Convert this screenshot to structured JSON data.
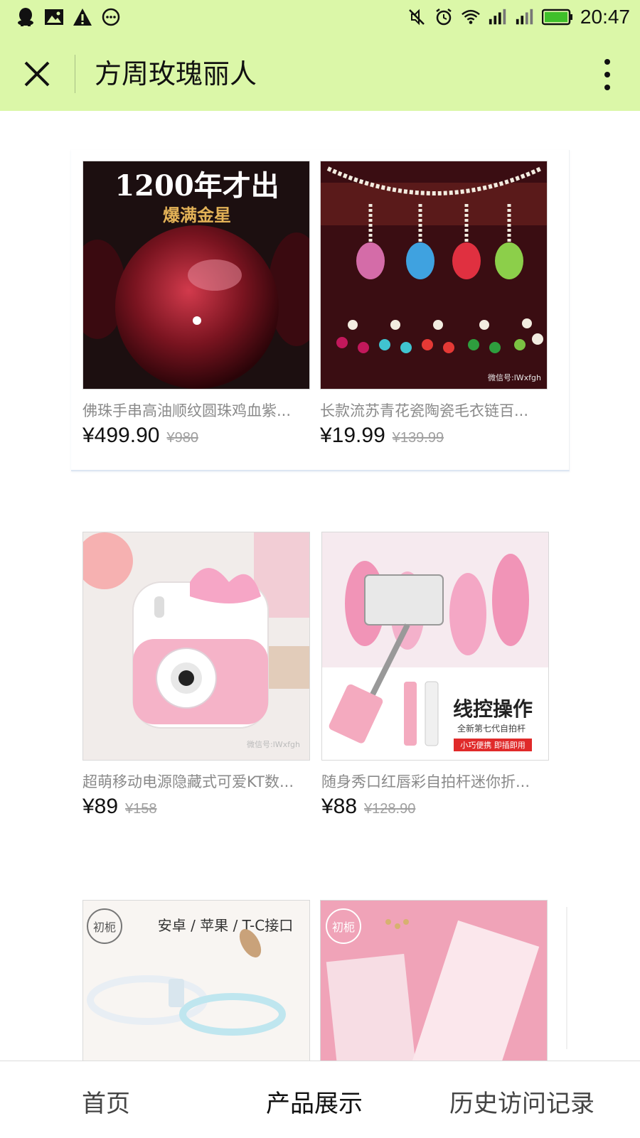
{
  "status_bar": {
    "time": "20:47",
    "left_icons": [
      "qq-icon",
      "image-icon",
      "warning-icon",
      "more-circle-icon"
    ],
    "right_icons": [
      "mute-icon",
      "alarm-icon",
      "wifi-icon",
      "signal-icon",
      "signal-icon",
      "battery-icon"
    ],
    "battery_color": "#3fbf2a"
  },
  "header": {
    "title": "方周玫瑰丽人",
    "background": "#dbf7a8"
  },
  "products": [
    {
      "name": "佛珠手串高油顺纹圆珠鸡血紫...",
      "price": "¥499.90",
      "original_price": "¥980",
      "image_text_1": "1200年才出",
      "image_text_2": "爆满金星"
    },
    {
      "name": "长款流苏青花瓷陶瓷毛衣链百...",
      "price": "¥19.99",
      "original_price": "¥139.99",
      "image_text_1": "微信号:lWxfgh"
    },
    {
      "name": "超萌移动电源隐藏式可爱KT数...",
      "price": "¥89",
      "original_price": "¥158",
      "image_text_1": "微信号:lWxfgh"
    },
    {
      "name": "随身秀口红唇彩自拍杆迷你折...",
      "price": "¥88",
      "original_price": "¥128.90",
      "image_text_1": "线控操作",
      "image_text_2": "全新第七代自拍杆",
      "image_text_3": "小巧便携 即插即用"
    },
    {
      "name": "",
      "price": "",
      "original_price": "",
      "image_text_1": "初枙",
      "image_text_2": "安卓 / 苹果 / T-C接口"
    },
    {
      "name": "",
      "price": "",
      "original_price": "",
      "image_text_1": "初枙"
    }
  ],
  "bottom_nav": {
    "items": [
      {
        "label": "首页"
      },
      {
        "label": "产品展示"
      },
      {
        "label": "历史访问记录"
      }
    ],
    "active_index": 1
  }
}
